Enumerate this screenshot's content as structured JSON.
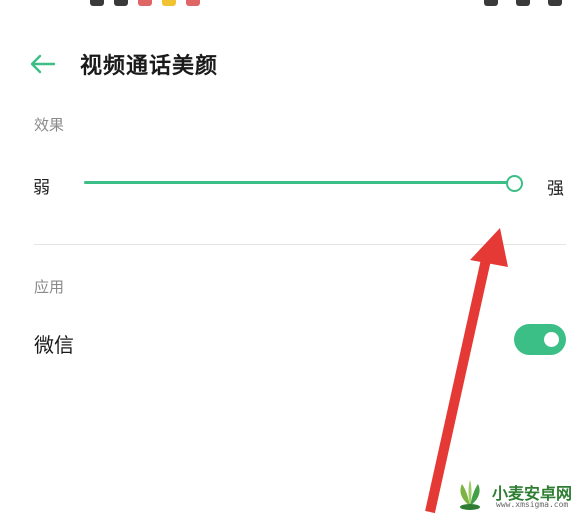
{
  "header": {
    "title": "视频通话美颜",
    "back_icon": "arrow-left-icon"
  },
  "effect": {
    "section_label": "效果",
    "min_label": "弱",
    "max_label": "强",
    "level": 1.0
  },
  "apply": {
    "section_label": "应用",
    "apps": [
      {
        "name": "微信",
        "enabled": true
      }
    ]
  },
  "annotation": {
    "type": "red-arrow",
    "points_to": "effect-slider-thumb"
  },
  "watermark": {
    "name": "小麦安卓网",
    "url": "www.xmsigma.com"
  },
  "colors": {
    "accent": "#3cbf86",
    "arrow": "#e53935",
    "label_gray": "#8a8a8a"
  }
}
